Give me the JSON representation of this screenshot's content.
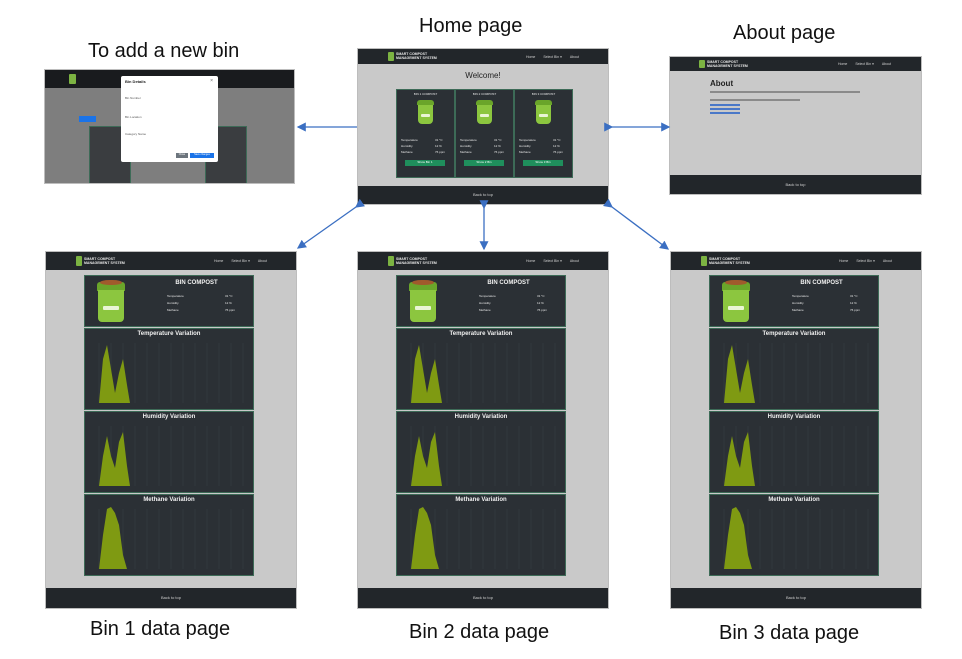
{
  "captions": {
    "add_bin": "To add a new bin",
    "home": "Home page",
    "about": "About page",
    "bin1": "Bin 1 data page",
    "bin2": "Bin 2 data page",
    "bin3": "Bin 3 data page"
  },
  "app": {
    "brand": "SMART COMPOST\nMANAGEMENT SYSTEM",
    "nav": [
      "Home",
      "Select Bin ▾",
      "About"
    ],
    "footer": "Back to top"
  },
  "home": {
    "welcome": "Welcome!",
    "bins": [
      {
        "title": "BIN 1 COMPOST",
        "button": "Show Bin 1"
      },
      {
        "title": "BIN 2 COMPOST",
        "button": "Show 2 Bin"
      },
      {
        "title": "BIN 3 COMPOST",
        "button": "Show 3 Bin"
      }
    ],
    "readings": [
      {
        "label": "Temperature",
        "value": "31 °C"
      },
      {
        "label": "Humidity",
        "value": "12 %"
      },
      {
        "label": "Methane",
        "value": "76 ppm"
      }
    ]
  },
  "about": {
    "heading": "About"
  },
  "add_bin": {
    "dialog_title": "Bin Details",
    "fields": [
      "Bin Number",
      "Bin Location",
      "Category Name"
    ],
    "close": "Close",
    "save": "Save changes"
  },
  "bin_page": {
    "title": "BIN COMPOST",
    "readings": [
      {
        "label": "Temperature",
        "value": "31 °C"
      },
      {
        "label": "Humidity",
        "value": "12 %"
      },
      {
        "label": "Methane",
        "value": "76 ppm"
      }
    ],
    "charts": [
      {
        "title": "Temperature Variation"
      },
      {
        "title": "Humidity Variation"
      },
      {
        "title": "Methane Variation"
      }
    ]
  },
  "colors": {
    "arrow": "#3b6fc2",
    "chart_fill": "#7f9a12",
    "panel": "#2b3035",
    "nav": "#22262a"
  }
}
